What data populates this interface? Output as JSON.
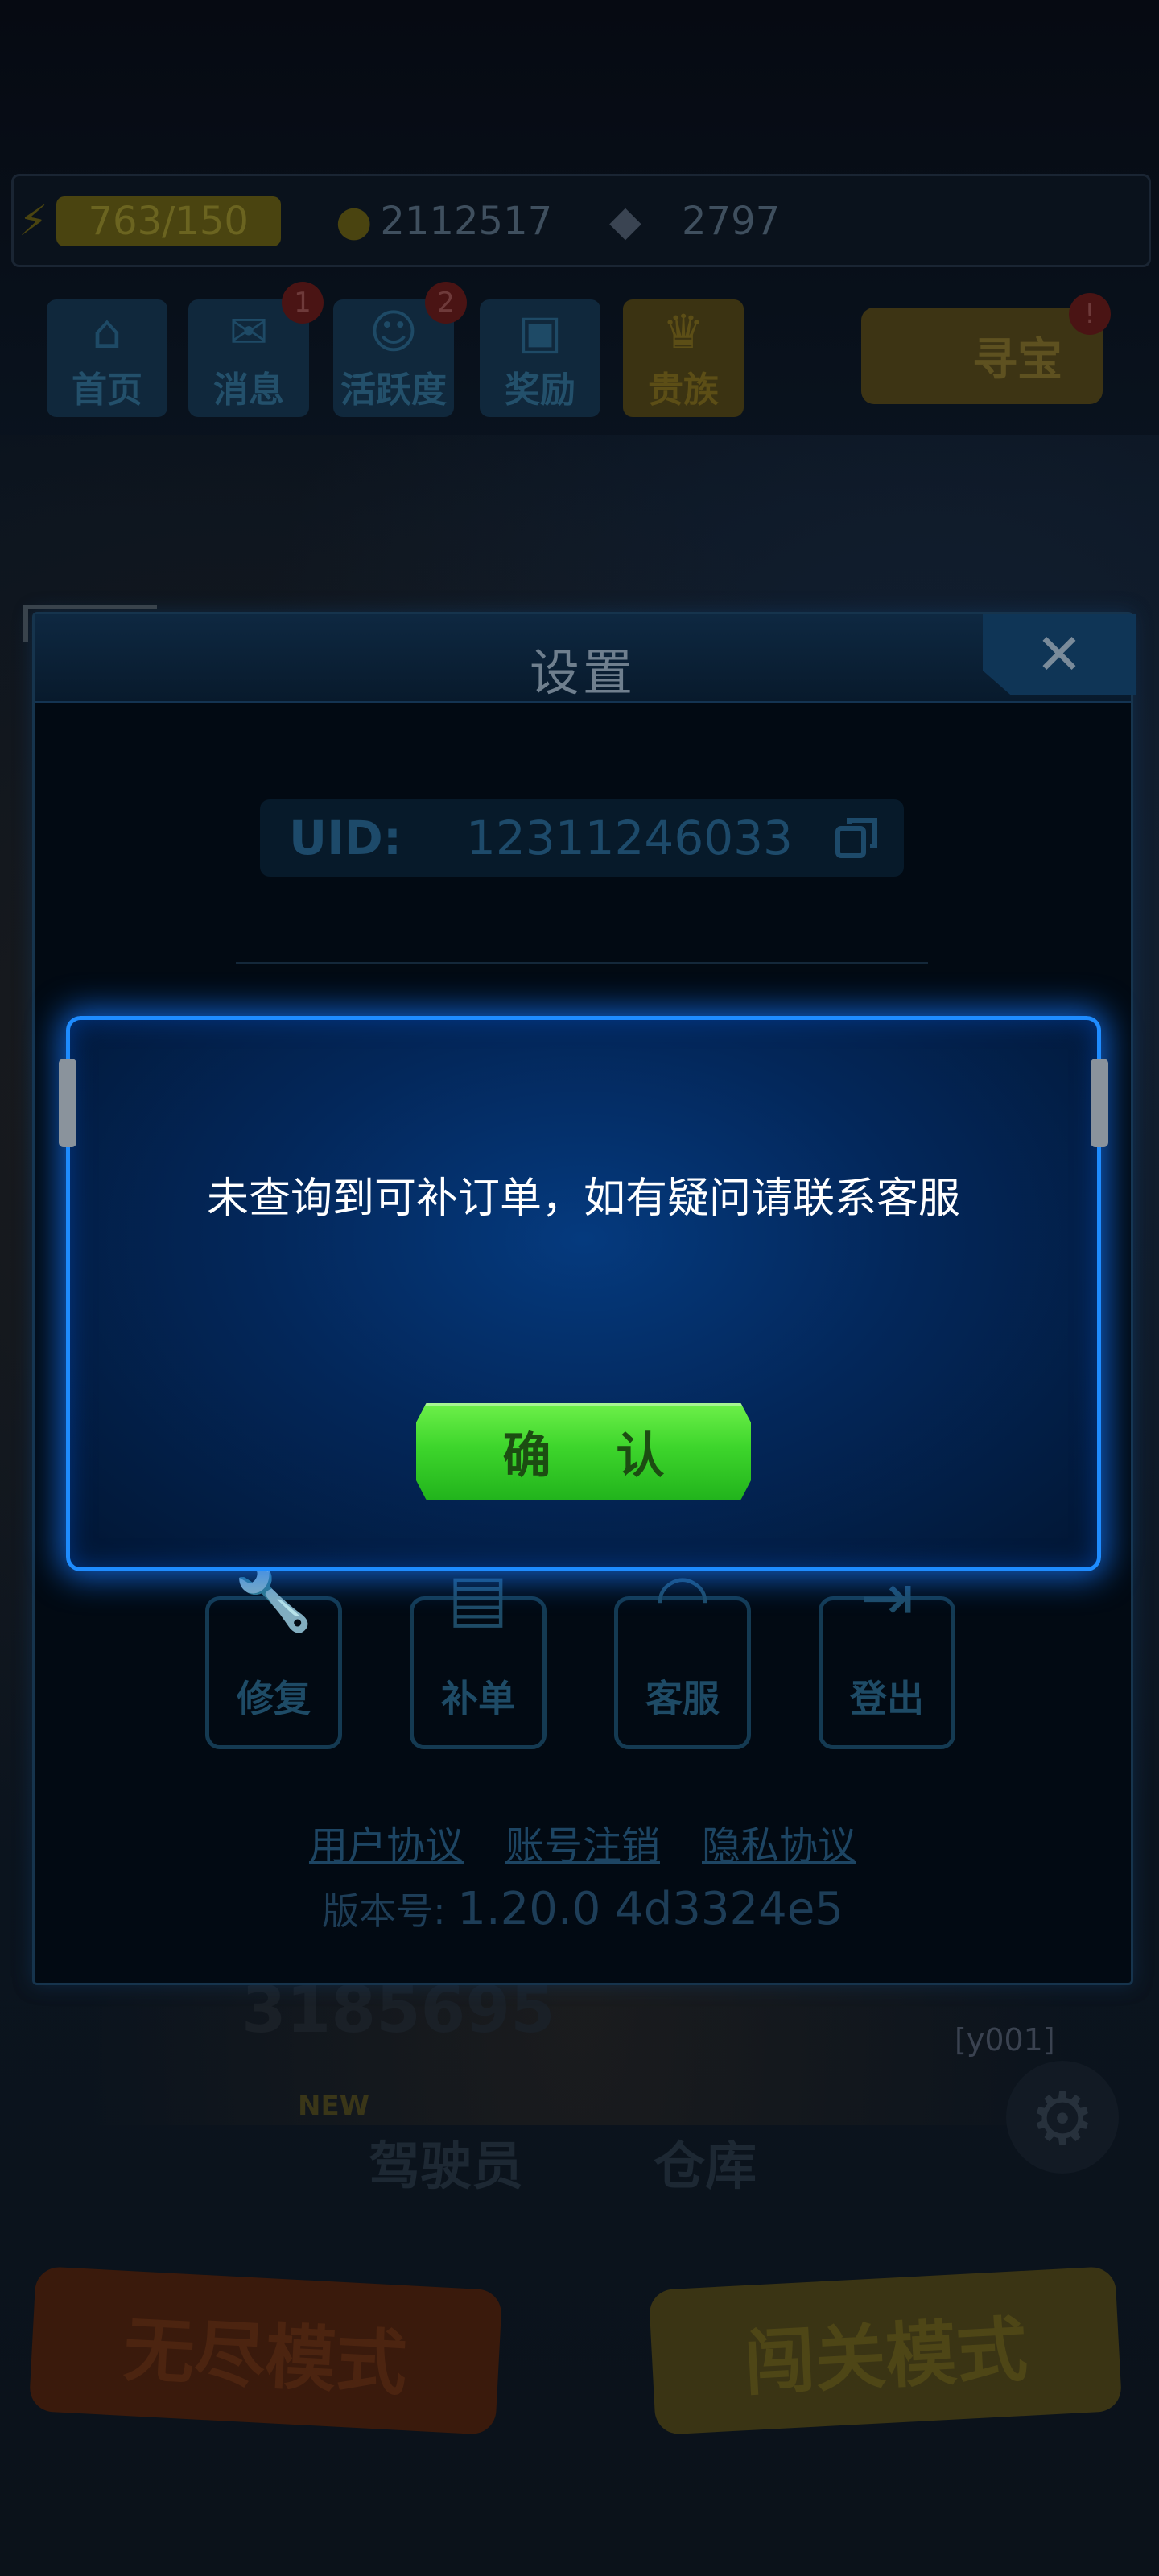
{
  "hud": {
    "energy": "763/150",
    "coins": "2112517",
    "gems": "2797"
  },
  "menu": [
    {
      "label": "首页",
      "icon": "home-icon",
      "badge": ""
    },
    {
      "label": "消息",
      "icon": "message-icon",
      "badge": "1"
    },
    {
      "label": "活跃度",
      "icon": "activity-icon",
      "badge": "2"
    },
    {
      "label": "奖励",
      "icon": "gift-icon",
      "badge": ""
    },
    {
      "label": "贵族",
      "icon": "crown-icon",
      "badge": ""
    }
  ],
  "treasure": {
    "label": "寻宝",
    "badge": "!"
  },
  "settings": {
    "title": "设置",
    "close": "✕",
    "uid_label": "UID:",
    "uid_value": "12311246033",
    "tools": [
      {
        "label": "修复",
        "icon": "wrench-icon"
      },
      {
        "label": "补单",
        "icon": "order-icon"
      },
      {
        "label": "客服",
        "icon": "headset-icon"
      },
      {
        "label": "登出",
        "icon": "logout-icon"
      }
    ],
    "links": [
      "用户协议",
      "账号注销",
      "隐私协议"
    ],
    "version_label": "版本号:",
    "version_value": "1.20.0   4d3324e5"
  },
  "background": {
    "score": "3185695",
    "tag": "[y001]",
    "new_badge": "NEW",
    "pilot": "驾驶员",
    "warehouse": "仓库",
    "endless_mode": "无尽模式",
    "level_mode": "闯关模式"
  },
  "dialog": {
    "message": "未查询到可补订单，如有疑问请联系客服",
    "confirm": "确 认"
  },
  "colors": {
    "dialog_border": "#1e8cff",
    "confirm_green": "#3ed62c"
  }
}
